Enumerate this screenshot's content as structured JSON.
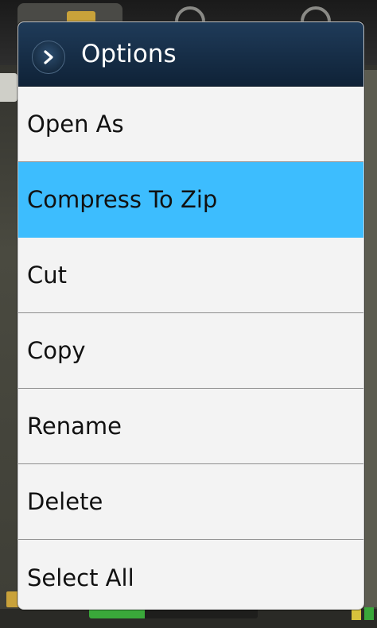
{
  "dialog": {
    "title": "Options",
    "header_icon": "chevron-right-icon",
    "selected_color": "#3dbdfe",
    "header_color": "#1a3450",
    "items": [
      {
        "label": "Open As",
        "selected": false
      },
      {
        "label": "Compress To Zip",
        "selected": true
      },
      {
        "label": "Cut",
        "selected": false
      },
      {
        "label": "Copy",
        "selected": false
      },
      {
        "label": "Rename",
        "selected": false
      },
      {
        "label": "Delete",
        "selected": false
      },
      {
        "label": "Select All",
        "selected": false
      }
    ]
  },
  "background": {
    "status_progress": 0.33
  }
}
